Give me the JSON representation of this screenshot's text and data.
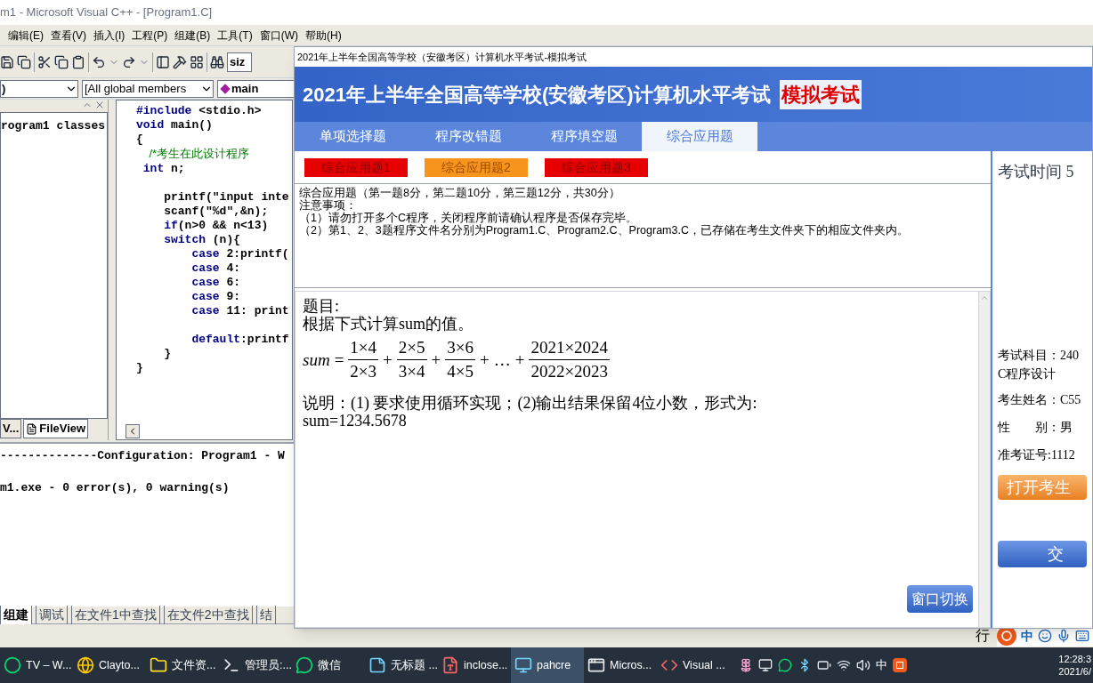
{
  "ide": {
    "title": "m1 - Microsoft Visual C++ - [Program1.C]",
    "menu": [
      "编辑(E)",
      "查看(V)",
      "插入(I)",
      "工程(P)",
      "组建(B)",
      "工具(T)",
      "窗口(W)",
      "帮助(H)"
    ],
    "toolbar_field": {
      "value": "siz"
    },
    "scope_combo": {
      "value": ")"
    },
    "members_combo": {
      "value": "[All global members"
    },
    "function_combo": {
      "value": "main"
    },
    "class_view": {
      "root": "rogram1 classes",
      "tabs": [
        {
          "label": "V...",
          "selected": false
        },
        {
          "label": "FileView",
          "selected": true
        }
      ]
    },
    "code_lines": [
      {
        "kind": "code",
        "segments": [
          {
            "kind": "kw",
            "text": "#include"
          },
          {
            "kind": "text",
            "text": " <stdio.h>"
          }
        ]
      },
      {
        "kind": "code",
        "segments": [
          {
            "kind": "kw",
            "text": "void"
          },
          {
            "kind": "text",
            "text": " main()"
          }
        ]
      },
      {
        "kind": "code",
        "segments": [
          {
            "kind": "text",
            "text": "{"
          }
        ]
      },
      {
        "kind": "code",
        "segments": [
          {
            "kind": "comment",
            "text": "    /*考生在此设计程序"
          }
        ]
      },
      {
        "kind": "code",
        "segments": [
          {
            "kind": "kw",
            "text": " int"
          },
          {
            "kind": "text",
            "text": " n;"
          }
        ]
      },
      {
        "kind": "blank"
      },
      {
        "kind": "code",
        "segments": [
          {
            "kind": "text",
            "text": "    printf(\"input inte"
          }
        ]
      },
      {
        "kind": "code",
        "segments": [
          {
            "kind": "text",
            "text": "    scanf(\"%d\",&n);"
          }
        ]
      },
      {
        "kind": "code",
        "segments": [
          {
            "kind": "kw",
            "text": "    if"
          },
          {
            "kind": "text",
            "text": "(n>0 && n<13)"
          }
        ]
      },
      {
        "kind": "code",
        "segments": [
          {
            "kind": "kw",
            "text": "    switch"
          },
          {
            "kind": "text",
            "text": " (n){"
          }
        ]
      },
      {
        "kind": "code",
        "segments": [
          {
            "kind": "kw",
            "text": "        case"
          },
          {
            "kind": "text",
            "text": " 2:printf("
          }
        ]
      },
      {
        "kind": "code",
        "segments": [
          {
            "kind": "kw",
            "text": "        case"
          },
          {
            "kind": "text",
            "text": " 4:"
          }
        ]
      },
      {
        "kind": "code",
        "segments": [
          {
            "kind": "kw",
            "text": "        case"
          },
          {
            "kind": "text",
            "text": " 6:"
          }
        ]
      },
      {
        "kind": "code",
        "segments": [
          {
            "kind": "kw",
            "text": "        case"
          },
          {
            "kind": "text",
            "text": " 9:"
          }
        ]
      },
      {
        "kind": "code",
        "segments": [
          {
            "kind": "kw",
            "text": "        case"
          },
          {
            "kind": "text",
            "text": " 11: print"
          }
        ]
      },
      {
        "kind": "blank"
      },
      {
        "kind": "code",
        "segments": [
          {
            "kind": "kw",
            "text": "        default"
          },
          {
            "kind": "text",
            "text": ":printf"
          }
        ]
      },
      {
        "kind": "code",
        "segments": [
          {
            "kind": "text",
            "text": "    }"
          }
        ]
      },
      {
        "kind": "code",
        "segments": [
          {
            "kind": "text",
            "text": "}"
          }
        ]
      }
    ],
    "output": {
      "lines": [
        "--------------Configuration: Program1 - W",
        "m1.exe - 0 error(s), 0 warning(s)"
      ],
      "tabs": [
        {
          "label": "组建",
          "selected": true
        },
        {
          "label": "调试",
          "selected": false
        },
        {
          "label": "在文件1中查找",
          "selected": false
        },
        {
          "label": "在文件2中查找",
          "selected": false
        },
        {
          "label": "结",
          "selected": false
        }
      ]
    },
    "status": {
      "text": "行"
    }
  },
  "ime_bar": {
    "mode": "中"
  },
  "exam": {
    "window_title": "2021年上半年全国高等学校（安徽考区）计算机水平考试-模拟考试",
    "heading": "2021年上半年全国高等学校(安徽考区)计算机水平考试",
    "heading_tag": "模拟考试",
    "tabs": [
      {
        "label": "单项选择题",
        "selected": false
      },
      {
        "label": "程序改错题",
        "selected": false
      },
      {
        "label": "程序填空题",
        "selected": false
      },
      {
        "label": "综合应用题",
        "selected": true
      }
    ],
    "questions": [
      {
        "label": "综合应用题1",
        "selected": false
      },
      {
        "label": "综合应用题2",
        "selected": true
      },
      {
        "label": "综合应用题3",
        "selected": false
      }
    ],
    "notice": [
      "综合应用题（第一题8分，第二题10分，第三题12分，共30分）",
      "注意事项：",
      "（1）请勿打开多个C程序，关闭程序前请确认程序是否保存完毕。",
      "（2）第1、2、3题程序文件名分别为Program1.C、Program2.C、Program3.C，已存储在考生文件夹下的相应文件夹内。"
    ],
    "question_title": "题目:",
    "question_text": "根据下式计算sum的值。",
    "formula": [
      {
        "kind": "var",
        "text": "sum"
      },
      {
        "kind": "op",
        "text": "="
      },
      {
        "kind": "frac",
        "numerator": "1×4",
        "denominator": "2×3"
      },
      {
        "kind": "op",
        "text": "+"
      },
      {
        "kind": "frac",
        "numerator": "2×5",
        "denominator": "3×4"
      },
      {
        "kind": "op",
        "text": "+"
      },
      {
        "kind": "frac",
        "numerator": "3×6",
        "denominator": "4×5"
      },
      {
        "kind": "op",
        "text": "+"
      },
      {
        "kind": "op",
        "text": "…"
      },
      {
        "kind": "op",
        "text": "+"
      },
      {
        "kind": "frac",
        "numerator": "2021×2024",
        "denominator": "2022×2023"
      }
    ],
    "remarks": [
      "说明：(1) 要求使用循环实现；(2)输出结果保留4位小数，形式为:",
      "sum=1234.5678"
    ],
    "switch_button": "窗口切换",
    "timer_label": "考试时间 5",
    "info": [
      "考试科目：240",
      "C程序设计",
      "考生姓名：C55",
      "性　　别：男",
      "准考证号:1112"
    ],
    "open_button": "打开考生",
    "submit_button": "交"
  },
  "taskbar": {
    "items": [
      {
        "kind": "ring",
        "label": "TV – W...",
        "selected": false
      },
      {
        "kind": "globe",
        "label": "Clayto...",
        "selected": false
      },
      {
        "kind": "folder",
        "label": "文件资...",
        "selected": false
      },
      {
        "kind": "terminal",
        "label": "管理员:...",
        "selected": false
      },
      {
        "kind": "chat",
        "label": "微信",
        "selected": false
      },
      {
        "kind": "note",
        "label": "无标题 ...",
        "selected": false
      },
      {
        "kind": "pdf",
        "label": "inclose...",
        "selected": false
      },
      {
        "kind": "remote",
        "label": "pahcre",
        "selected": true
      },
      {
        "kind": "window",
        "label": "Micros...",
        "selected": false
      },
      {
        "kind": "code",
        "label": "Visual ...",
        "selected": false
      }
    ],
    "tray_lang": "中",
    "time": "12:28:3",
    "date": "2021/6/"
  }
}
